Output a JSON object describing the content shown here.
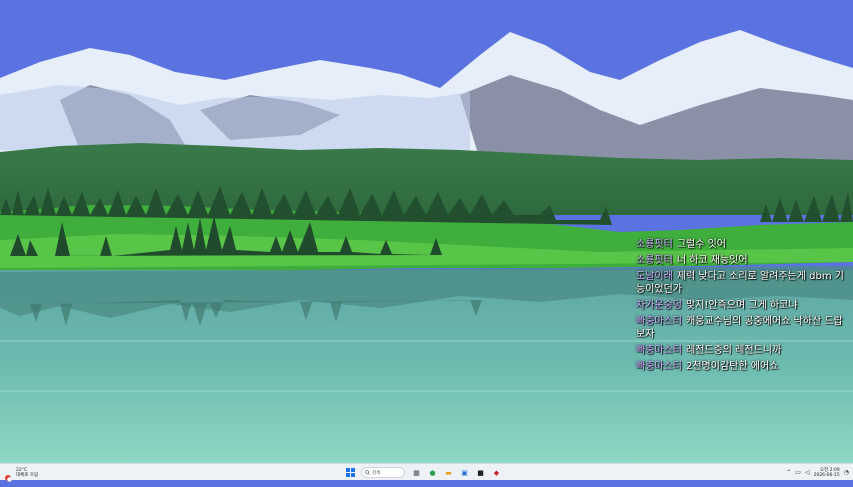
{
  "chat": {
    "messages": [
      {
        "user": "소룡핏터",
        "text": "그럴수 잇어",
        "color": "#c9b3ff"
      },
      {
        "user": "소룡핏터",
        "text": "너 하코 재능잇어",
        "color": "#c9b3ff"
      },
      {
        "user": "도날이래",
        "text": "제력 낮다고 소리로 알려주는게 dbm 기능이었던가",
        "color": "#c9b3ff"
      },
      {
        "user": "차가운숭덩",
        "text": "맞지!안즉으며 그게 하코냐",
        "color": "#c9b3ff"
      },
      {
        "user": "빠충마스터",
        "text": "캐웅교수님의 공중에어쇼 낙하산 드랍보자",
        "color": "#c9b3ff"
      },
      {
        "user": "빠충마스터",
        "text": "레전드중의 레전드니까",
        "color": "#c9b3ff"
      },
      {
        "user": "빠충마스터",
        "text": "2천명이감탄한 에어쇼",
        "color": "#c9b3ff"
      }
    ]
  },
  "taskbar": {
    "weather": {
      "temp": "22°C",
      "desc": "대체로 흐림",
      "icon": "weather-icon"
    },
    "search": {
      "placeholder": "검색",
      "icon": "search-icon"
    },
    "apps": [
      {
        "name": "taskbar-app-game",
        "glyph": "▦",
        "color": "#444a5a"
      },
      {
        "name": "taskbar-app-chrome",
        "glyph": "●",
        "color": "#2a9d4a"
      },
      {
        "name": "taskbar-app-explorer",
        "glyph": "▬",
        "color": "#e0a020"
      },
      {
        "name": "taskbar-app-store",
        "glyph": "▣",
        "color": "#2b6fd6"
      },
      {
        "name": "taskbar-app-media",
        "glyph": "■",
        "color": "#222222"
      },
      {
        "name": "taskbar-app-bird",
        "glyph": "◆",
        "color": "#c8262e"
      }
    ],
    "clock": {
      "time": "오전 2:09",
      "date": "2026-06-15"
    }
  }
}
